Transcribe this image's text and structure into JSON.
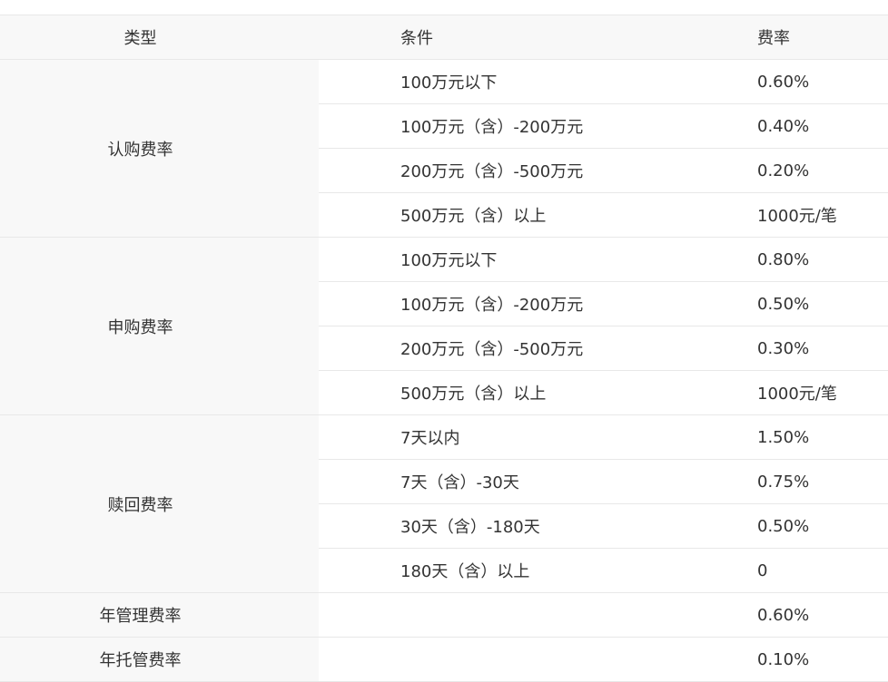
{
  "header": {
    "type": "类型",
    "condition": "条件",
    "rate": "费率"
  },
  "groups": [
    {
      "type": "认购费率",
      "rows": [
        {
          "condition": "100万元以下",
          "rate": "0.60%"
        },
        {
          "condition": "100万元（含）-200万元",
          "rate": "0.40%"
        },
        {
          "condition": "200万元（含）-500万元",
          "rate": "0.20%"
        },
        {
          "condition": "500万元（含）以上",
          "rate": "1000元/笔"
        }
      ]
    },
    {
      "type": "申购费率",
      "rows": [
        {
          "condition": "100万元以下",
          "rate": "0.80%"
        },
        {
          "condition": "100万元（含）-200万元",
          "rate": "0.50%"
        },
        {
          "condition": "200万元（含）-500万元",
          "rate": "0.30%"
        },
        {
          "condition": "500万元（含）以上",
          "rate": "1000元/笔"
        }
      ]
    },
    {
      "type": "赎回费率",
      "rows": [
        {
          "condition": "7天以内",
          "rate": "1.50%"
        },
        {
          "condition": "7天（含）-30天",
          "rate": "0.75%"
        },
        {
          "condition": "30天（含）-180天",
          "rate": "0.50%"
        },
        {
          "condition": "180天（含）以上",
          "rate": "0"
        }
      ]
    },
    {
      "type": "年管理费率",
      "rows": [
        {
          "condition": "",
          "rate": "0.60%"
        }
      ]
    },
    {
      "type": "年托管费率",
      "rows": [
        {
          "condition": "",
          "rate": "0.10%"
        }
      ]
    }
  ]
}
